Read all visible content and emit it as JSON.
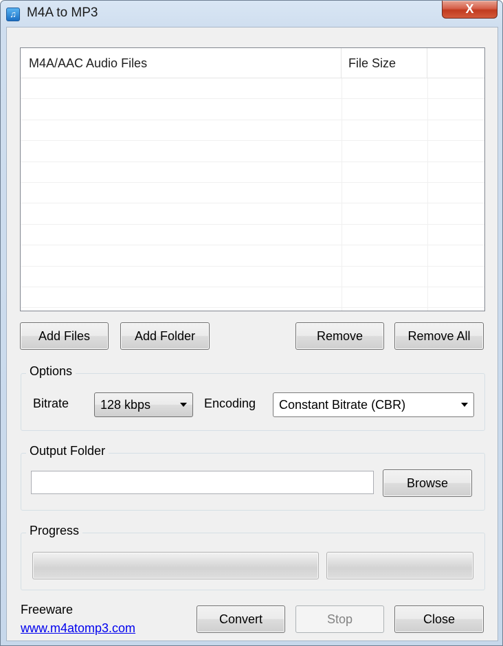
{
  "window": {
    "title": "M4A to MP3",
    "app_icon": "music-note-icon",
    "close_label": "X"
  },
  "file_list": {
    "columns": [
      "M4A/AAC Audio Files",
      "File Size",
      ""
    ],
    "rows": []
  },
  "file_buttons": {
    "add_files": "Add Files",
    "add_folder": "Add Folder",
    "remove": "Remove",
    "remove_all": "Remove All"
  },
  "options": {
    "group_label": "Options",
    "bitrate_label": "Bitrate",
    "bitrate_value": "128 kbps",
    "encoding_label": "Encoding",
    "encoding_value": "Constant Bitrate (CBR)"
  },
  "output": {
    "group_label": "Output Folder",
    "folder_value": "",
    "browse_label": "Browse"
  },
  "progress": {
    "group_label": "Progress",
    "file_progress_percent": 0,
    "total_progress_percent": 0
  },
  "footer": {
    "freeware_label": "Freeware",
    "website_link": "www.m4atomp3.com",
    "convert_label": "Convert",
    "stop_label": "Stop",
    "close_label": "Close"
  }
}
